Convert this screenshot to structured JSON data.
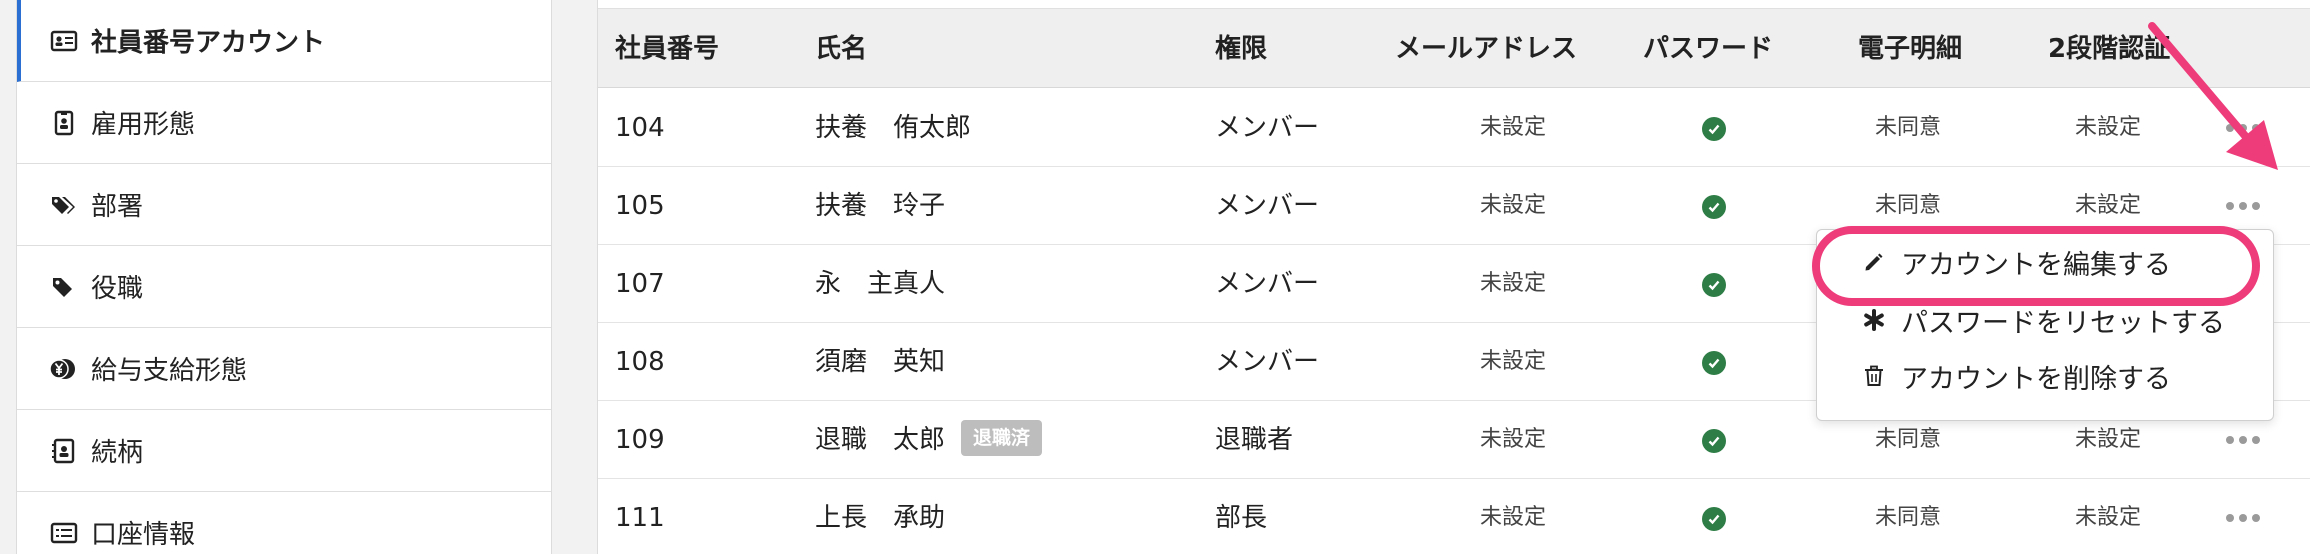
{
  "sidebar": {
    "items": [
      {
        "label": "社員番号アカウント",
        "icon": "id-card-icon",
        "active": true
      },
      {
        "label": "雇用形態",
        "icon": "badge-icon",
        "active": false
      },
      {
        "label": "部署",
        "icon": "tags-icon",
        "active": false
      },
      {
        "label": "役職",
        "icon": "tag-icon",
        "active": false
      },
      {
        "label": "給与支給形態",
        "icon": "yen-coins-icon",
        "active": false
      },
      {
        "label": "続柄",
        "icon": "contact-book-icon",
        "active": false
      },
      {
        "label": "口座情報",
        "icon": "list-card-icon",
        "active": false
      }
    ]
  },
  "table": {
    "headers": {
      "employee_no": "社員番号",
      "name": "氏名",
      "role": "権限",
      "email": "メールアドレス",
      "password": "パスワード",
      "e_statement": "電子明細",
      "two_factor": "2段階認証"
    },
    "rows": [
      {
        "employee_no": "104",
        "name": "扶養　侑太郎",
        "badge": "",
        "role": "メンバー",
        "email": "未設定",
        "password": "check-icon",
        "e_statement": "未同意",
        "two_factor": "未設定"
      },
      {
        "employee_no": "105",
        "name": "扶養　玲子",
        "badge": "",
        "role": "メンバー",
        "email": "未設定",
        "password": "check-icon",
        "e_statement": "未同意",
        "two_factor": "未設定"
      },
      {
        "employee_no": "107",
        "name": "永　主真人",
        "badge": "",
        "role": "メンバー",
        "email": "未設定",
        "password": "check-icon",
        "e_statement": "",
        "two_factor": ""
      },
      {
        "employee_no": "108",
        "name": "須磨　英知",
        "badge": "",
        "role": "メンバー",
        "email": "未設定",
        "password": "check-icon",
        "e_statement": "",
        "two_factor": ""
      },
      {
        "employee_no": "109",
        "name": "退職　太郎",
        "badge": "退職済",
        "role": "退職者",
        "email": "未設定",
        "password": "check-icon",
        "e_statement": "未同意",
        "two_factor": "未設定"
      },
      {
        "employee_no": "111",
        "name": "上長　承助",
        "badge": "",
        "role": "部長",
        "email": "未設定",
        "password": "check-icon",
        "e_statement": "未同意",
        "two_factor": "未設定"
      }
    ]
  },
  "menu": {
    "items": [
      {
        "label": "アカウントを編集する",
        "icon": "pencil-icon"
      },
      {
        "label": "パスワードをリセットする",
        "icon": "asterisk-icon"
      },
      {
        "label": "アカウントを削除する",
        "icon": "trash-icon"
      }
    ]
  },
  "colors": {
    "accent": "#2a6fd1",
    "highlight": "#ee3b7a",
    "check": "#2e7d46",
    "badge": "#bdbdbd"
  }
}
